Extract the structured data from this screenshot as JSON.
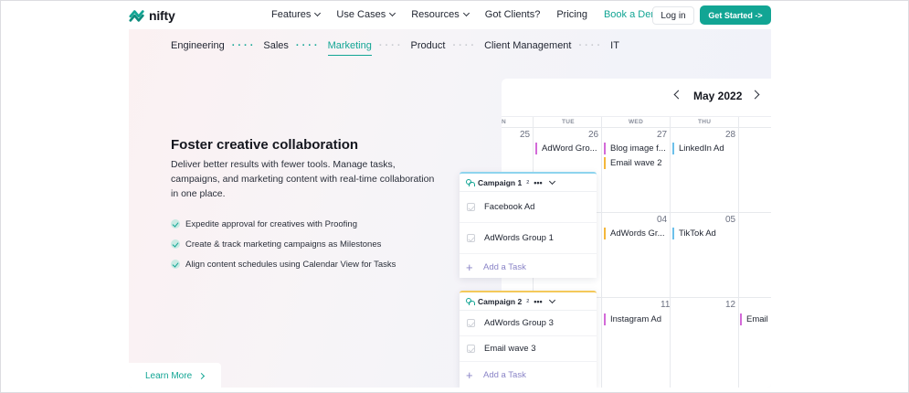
{
  "brand": {
    "name": "nifty",
    "accent": "#12a594"
  },
  "nav": {
    "items": [
      {
        "label": "Features",
        "dropdown": true
      },
      {
        "label": "Use Cases",
        "dropdown": true
      },
      {
        "label": "Resources",
        "dropdown": true
      },
      {
        "label": "Got Clients?",
        "dropdown": false
      },
      {
        "label": "Pricing",
        "dropdown": false
      },
      {
        "label": "Book a Demo",
        "dropdown": false
      }
    ],
    "login": "Log in",
    "get_started": "Get Started ->"
  },
  "tabs": [
    "Engineering",
    "Sales",
    "Marketing",
    "Product",
    "Client Management",
    "IT"
  ],
  "active_tab": "Marketing",
  "hero": {
    "title": "Foster creative collaboration",
    "description": "Deliver better results with fewer tools. Manage tasks, campaigns, and marketing content with real-time collaboration in one place.",
    "features": [
      "Expedite approval for creatives with Proofing",
      "Create & track marketing campaigns as Milestones",
      "Align content schedules using Calendar View for Tasks"
    ],
    "learn_more": "Learn More"
  },
  "calendar": {
    "month": "May 2022",
    "days_of_week": [
      "N",
      "TUE",
      "WED",
      "THU"
    ],
    "day_numbers": [
      "25",
      "26",
      "27",
      "28",
      "04",
      "05",
      "11",
      "12"
    ],
    "events": [
      {
        "label": "AdWord Gro...",
        "color": "purple"
      },
      {
        "label": "Blog image f...",
        "color": "purple"
      },
      {
        "label": "Email wave 2",
        "color": "yellow"
      },
      {
        "label": "LinkedIn Ad",
        "color": "blue"
      },
      {
        "label": "AdWords Gr...",
        "color": "yellow"
      },
      {
        "label": "TikTok Ad",
        "color": "blue"
      },
      {
        "label": "Instagram Ad",
        "color": "purple"
      },
      {
        "label": "Email",
        "color": "purple"
      }
    ]
  },
  "campaigns": [
    {
      "name": "Campaign 1",
      "count": "2",
      "tasks": [
        "Facebook Ad",
        "AdWords Group 1"
      ],
      "add_task": "Add a Task"
    },
    {
      "name": "Campaign 2",
      "count": "2",
      "tasks": [
        "AdWords Group 3",
        "Email wave 3"
      ],
      "add_task": "Add a Task"
    }
  ]
}
